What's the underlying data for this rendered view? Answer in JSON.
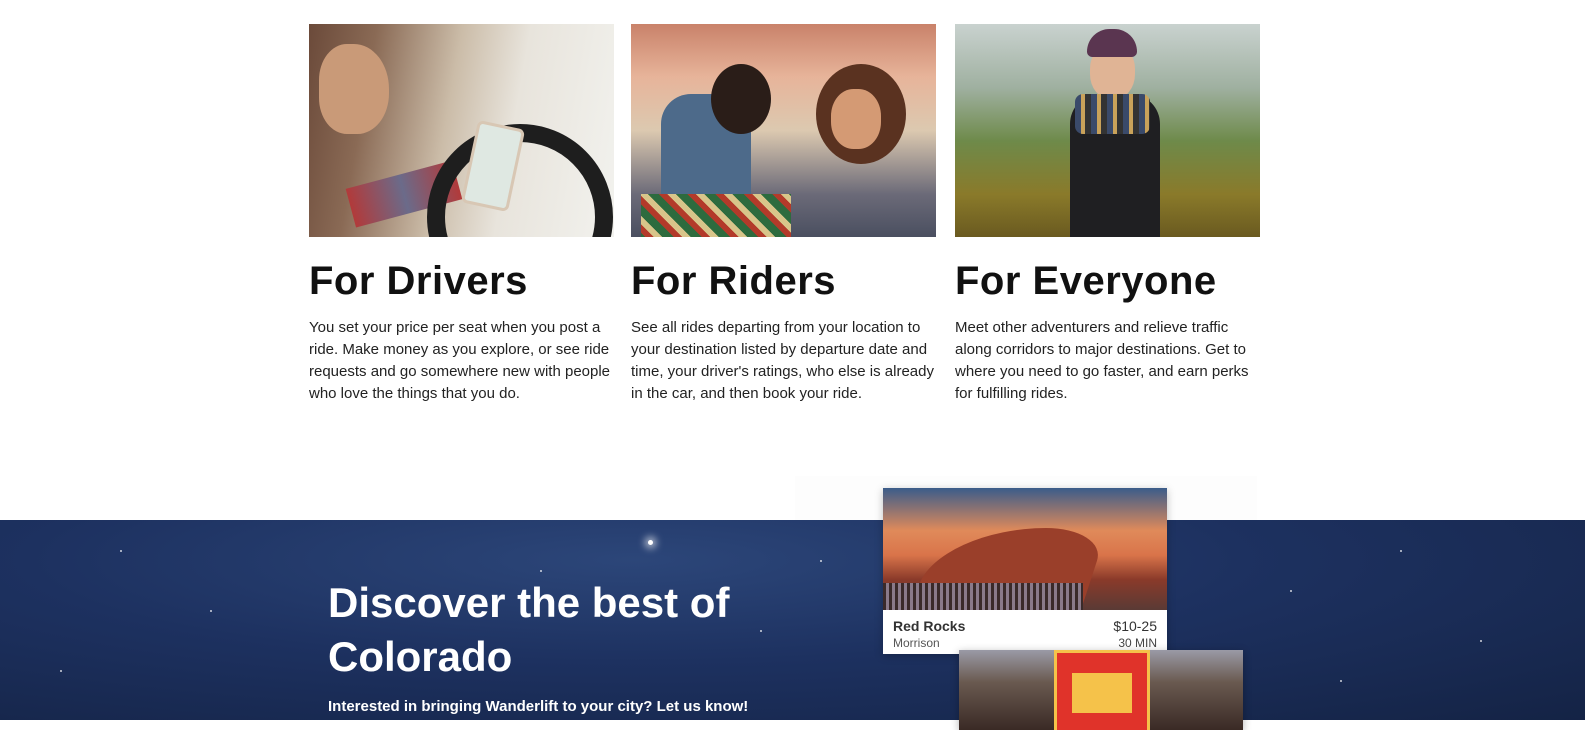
{
  "features": [
    {
      "title": "For Drivers",
      "body": "You set your price per seat when you post a ride. Make money as you explore, or see ride requests and go somewhere new with people who love the things that you do."
    },
    {
      "title": "For Riders",
      "body": "See all rides departing from your location to your destination listed by departure date and time, your driver's ratings, who else is already in the car, and then book your ride."
    },
    {
      "title": "For Everyone",
      "body": "Meet other adventurers and relieve traffic along corridors to major destinations. Get to where you need to go faster, and earn perks for fulfilling rides."
    }
  ],
  "hero": {
    "title": "Discover the best of Colorado",
    "cta": "Interested in bringing Wanderlift to your city? Let us know!"
  },
  "destinations": [
    {
      "name": "Red Rocks",
      "location": "Morrison",
      "price": "$10-25",
      "duration": "30 MIN"
    }
  ],
  "colors": {
    "hero_bg": "#1d3160",
    "heading": "#111111",
    "text": "#222222"
  }
}
